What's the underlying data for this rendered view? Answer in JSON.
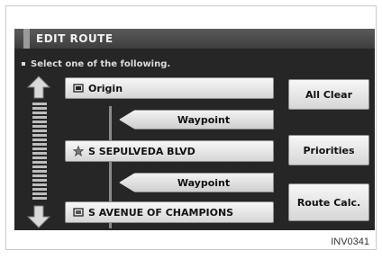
{
  "header": {
    "title": "EDIT ROUTE"
  },
  "instruction": "Select one of the following.",
  "route": {
    "origin": "Origin",
    "waypoint_1": "Waypoint",
    "destination_1": "S SEPULVEDA BLVD",
    "waypoint_2": "Waypoint",
    "destination_2": "S AVENUE OF CHAMPIONS"
  },
  "buttons": {
    "all_clear": "All Clear",
    "priorities": "Priorities",
    "route_calc": "Route Calc."
  },
  "caption": "INV0341",
  "colors": {
    "screen_bg": "#262626",
    "button_face": "#e6e6e6",
    "text": "#111111"
  }
}
